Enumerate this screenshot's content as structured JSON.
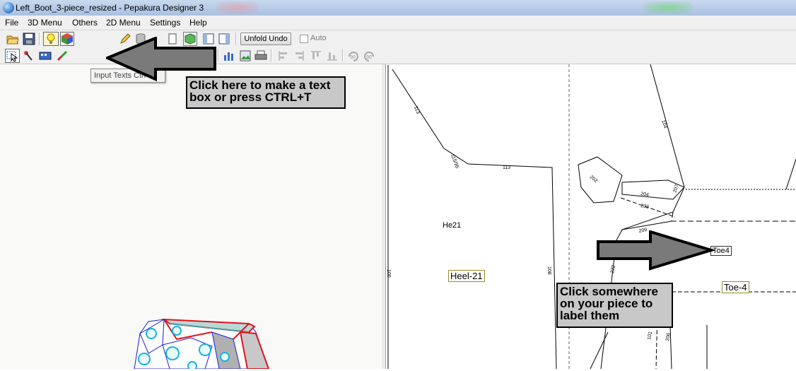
{
  "window": {
    "title": "Left_Boot_3-piece_resized - Pepakura Designer 3"
  },
  "menu": [
    "File",
    "3D Menu",
    "Others",
    "2D Menu",
    "Settings",
    "Help"
  ],
  "toolbar": {
    "unfold_undo": "Unfold Undo",
    "auto_label": "Auto",
    "auto_checked": false
  },
  "tooltip": "Input Texts Ctrl+T",
  "annotations": {
    "top_callout_line1": "Click here to make a text",
    "top_callout_line2": "box or press CTRL+T",
    "bottom_callout_line1": "Click somewhere",
    "bottom_callout_line2": "on your piece to",
    "bottom_callout_line3": "label them"
  },
  "pattern_labels": {
    "he21": "He21",
    "heel21": "Heel-21",
    "toe4_small": "Toe4",
    "toe4": "Toe-4"
  },
  "edge_numbers": [
    "113",
    "115/95",
    "104",
    "100",
    "202",
    "204",
    "203",
    "209",
    "222",
    "207",
    "206",
    "101",
    "108"
  ],
  "colors": {
    "callout_fill": "#c8c8c8",
    "arrow_fill": "#7a7a7a",
    "highlight_blue": "#1a8fe0",
    "model_red": "#e0141e"
  }
}
